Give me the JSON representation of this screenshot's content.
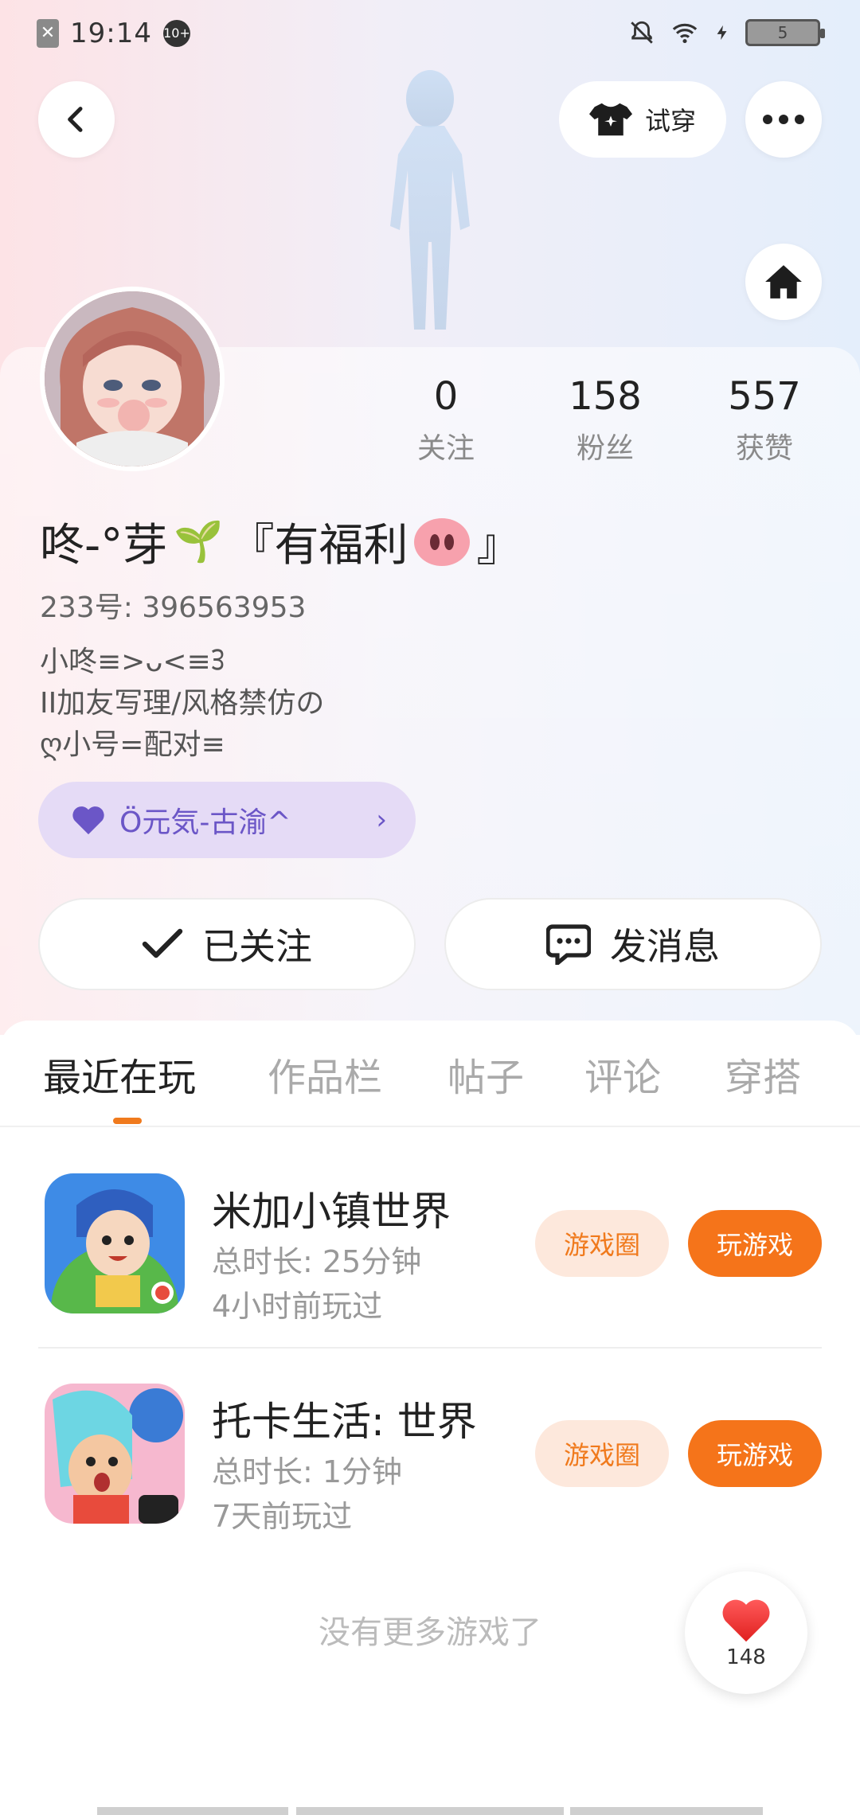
{
  "status_bar": {
    "time": "19:14",
    "notification_badge": "10+",
    "battery": "5",
    "icons": [
      "sim-x-icon",
      "mute-bell-icon",
      "wifi-icon",
      "charging-icon",
      "battery-icon"
    ]
  },
  "header": {
    "try_on_label": "试穿",
    "back_icon": "back-arrow-icon",
    "more_icon": "more-dots-icon",
    "home_icon": "home-icon",
    "try_on_icon": "tshirt-icon"
  },
  "stats": [
    {
      "num": "0",
      "label": "关注"
    },
    {
      "num": "158",
      "label": "粉丝"
    },
    {
      "num": "557",
      "label": "获赞"
    }
  ],
  "profile": {
    "nickname_part1": "咚-°芽",
    "nickname_part2": "『有福利",
    "nickname_part3": "』",
    "uid": "233号: 396563953",
    "bio_line1": "小咚≡>ᴗ<≡ᢃ",
    "bio_line2": "II加友写理/风格禁仿の",
    "bio_line3": "ღ小号=配对≡"
  },
  "guild": {
    "label": "Ö元気-古渝^",
    "heart_color": "#6b56c7"
  },
  "actions": {
    "follow_label": "已关注",
    "message_label": "发消息"
  },
  "tabs": [
    "最近在玩",
    "作品栏",
    "帖子",
    "评论",
    "穿搭"
  ],
  "active_tab": "最近在玩",
  "games": [
    {
      "name": "米加小镇世界",
      "time": "总时长: 25分钟",
      "last": "4小时前玩过",
      "circle": "游戏圈",
      "play": "玩游戏"
    },
    {
      "name": "托卡生活: 世界",
      "time": "总时长: 1分钟",
      "last": "7天前玩过",
      "circle": "游戏圈",
      "play": "玩游戏"
    }
  ],
  "footer": {
    "no_more": "没有更多游戏了",
    "like_count": "148"
  },
  "colors": {
    "accent": "#f5741a",
    "accent_soft": "#fde8dc",
    "guild_bg": "#e5dbf6"
  }
}
